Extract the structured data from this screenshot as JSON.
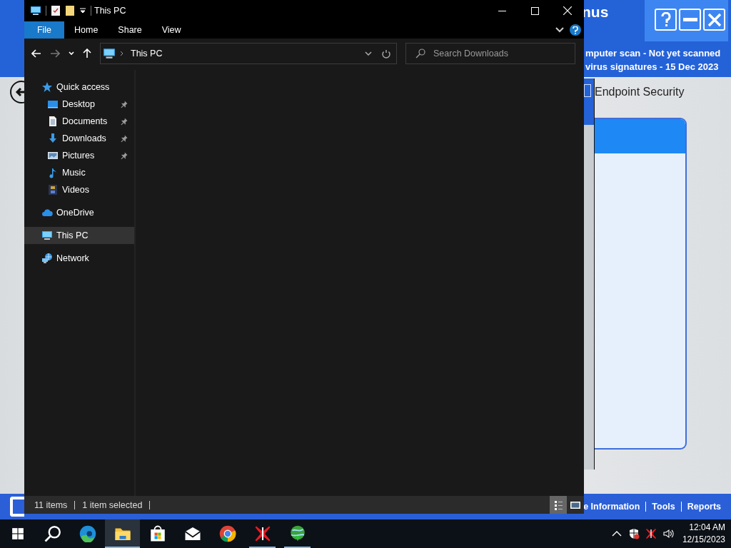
{
  "background_app": {
    "title": "nus",
    "status_lines": [
      "mputer scan - Not yet scanned",
      "virus signatures - 15 Dec 2023"
    ],
    "section_title": "Endpoint Security",
    "footer_links": [
      "e Information",
      "Tools",
      "Reports"
    ]
  },
  "explorer": {
    "title": "This PC",
    "ribbon_tabs": [
      {
        "label": "File",
        "kind": "menu"
      },
      {
        "label": "Home",
        "kind": "tab"
      },
      {
        "label": "Share",
        "kind": "tab"
      },
      {
        "label": "View",
        "kind": "tab"
      }
    ],
    "address": {
      "crumbs": [
        "This PC"
      ]
    },
    "search": {
      "placeholder": "Search Downloads"
    },
    "nav": [
      {
        "label": "Quick access",
        "kind": "star",
        "selected": false,
        "children": [
          {
            "label": "Desktop",
            "kind": "desktop",
            "pinned": true,
            "selected": false
          },
          {
            "label": "Documents",
            "kind": "document",
            "pinned": true,
            "selected": false
          },
          {
            "label": "Downloads",
            "kind": "download",
            "pinned": true,
            "selected": false
          },
          {
            "label": "Pictures",
            "kind": "picture",
            "pinned": true,
            "selected": false
          },
          {
            "label": "Music",
            "kind": "music",
            "pinned": false,
            "selected": false
          },
          {
            "label": "Videos",
            "kind": "video",
            "pinned": false,
            "selected": false
          }
        ]
      },
      {
        "label": "OneDrive",
        "kind": "cloud",
        "selected": false
      },
      {
        "label": "This PC",
        "kind": "pc",
        "selected": true
      },
      {
        "label": "Network",
        "kind": "network",
        "selected": false
      }
    ],
    "status": {
      "item_count": "11 items",
      "selection": "1 item selected"
    },
    "view_buttons": [
      {
        "kind": "details",
        "selected": true
      },
      {
        "kind": "tiles",
        "selected": false
      }
    ]
  },
  "taskbar": {
    "buttons": [
      {
        "kind": "start",
        "selected": false,
        "running": false
      },
      {
        "kind": "search",
        "selected": false,
        "running": false
      },
      {
        "kind": "edge",
        "selected": false,
        "running": false
      },
      {
        "kind": "explorer",
        "selected": true,
        "running": true
      },
      {
        "kind": "store",
        "selected": false,
        "running": false
      },
      {
        "kind": "mail",
        "selected": false,
        "running": false
      },
      {
        "kind": "chrome",
        "selected": false,
        "running": false
      },
      {
        "kind": "redx",
        "selected": false,
        "running": true
      },
      {
        "kind": "globe",
        "selected": false,
        "running": true
      }
    ],
    "tray_icons": [
      {
        "kind": "chevron"
      },
      {
        "kind": "shield"
      },
      {
        "kind": "redx"
      },
      {
        "kind": "speaker"
      }
    ],
    "clock": {
      "time": "12:04 AM",
      "date": "12/15/2023"
    }
  }
}
